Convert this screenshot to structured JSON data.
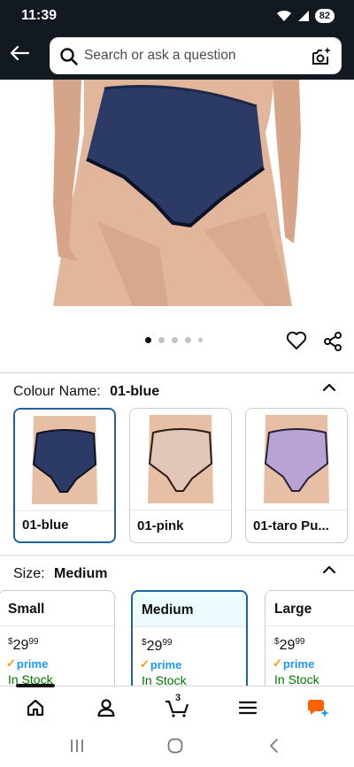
{
  "status_bar": {
    "time": "11:39",
    "battery": "82"
  },
  "search": {
    "placeholder": "Search or ask a question"
  },
  "product": {
    "image_alt": "navy blue briefs",
    "carousel_dots": 5,
    "active_dot": 0
  },
  "colour": {
    "label": "Colour Name:",
    "selected": "01-blue",
    "options": [
      {
        "name": "01-blue",
        "swatch": "#2c3a66",
        "selected": true
      },
      {
        "name": "01-pink",
        "swatch": "#e2c6b8",
        "selected": false
      },
      {
        "name": "01-taro Pu...",
        "swatch": "#b8a4d4",
        "selected": false
      }
    ]
  },
  "size": {
    "label": "Size:",
    "selected": "Medium",
    "options": [
      {
        "name": "Small",
        "price_dollars": "29",
        "price_cents": "99",
        "prime": "prime",
        "stock": "In Stock",
        "selected": false
      },
      {
        "name": "Medium",
        "price_dollars": "29",
        "price_cents": "99",
        "prime": "prime",
        "stock": "In Stock",
        "selected": true
      },
      {
        "name": "Large",
        "price_dollars": "29",
        "price_cents": "99",
        "prime": "prime",
        "stock": "In Stock",
        "selected": false
      }
    ]
  },
  "bottom_nav": {
    "items": [
      "home-icon",
      "account-icon",
      "cart-icon",
      "menu-icon",
      "rufus-icon"
    ],
    "cart_count": "3"
  },
  "colors": {
    "header_bg": "#131921",
    "accent_blue": "#2162a1",
    "prime_blue": "#1a98ff",
    "stock_green": "#007600"
  }
}
